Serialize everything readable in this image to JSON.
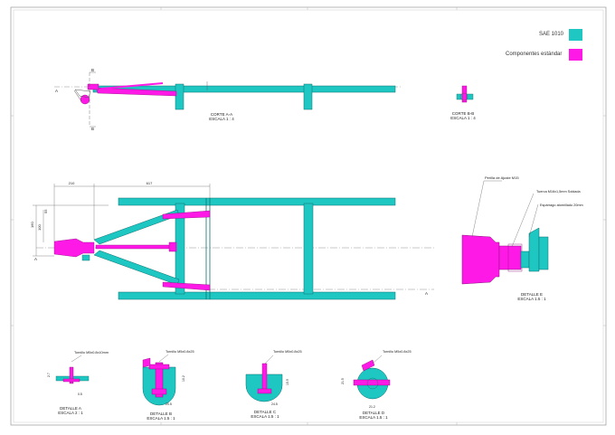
{
  "legend": {
    "items": [
      {
        "label": "SAE 1010",
        "color": "#1fc7c3"
      },
      {
        "label": "Componentes estándar",
        "color": "#ff19e6"
      }
    ]
  },
  "colors": {
    "frame": "#1fc7c3",
    "standard": "#ff19e6",
    "line": "#5a5a5a"
  },
  "views": {
    "corte_aa": {
      "title": "CORTE A-A",
      "scale": "ESCALA 1 : 4"
    },
    "corte_bb": {
      "title": "CORTE B-B",
      "scale": "ESCALA 1 : 4"
    },
    "detalle_e": {
      "title": "DETALLE E",
      "scale": "ESCALA 1.5 : 1"
    },
    "detalle_a": {
      "title": "DETALLE A",
      "scale": "ESCALA 2 : 1",
      "callout": "Tornillo M5x0.8x10mm"
    },
    "detalle_b": {
      "title": "DETALLE B",
      "scale": "ESCALA 1.5 : 1",
      "callout": "Tornillo M5x0.8x25"
    },
    "detalle_c": {
      "title": "DETALLE C",
      "scale": "ESCALA 1.5 : 1",
      "callout": "Tornillo M5x0.8x25"
    },
    "detalle_d": {
      "title": "DETALLE D",
      "scale": "ESCALA 1.5 : 1",
      "callout": "Tornillo M5x0.8x25"
    }
  },
  "callouts": {
    "perilla": "Perilla de Ajuste M15",
    "tuerca": "Tuerca M16x1,5mm Soldada",
    "esparrago": "Espárrago atornillado 20mm"
  },
  "dimensions": {
    "d1": "210",
    "d2": "617",
    "d3": "160",
    "d4": "100",
    "d5": "55",
    "a_h": "2.7",
    "a_w": "0.5",
    "b_v": "10.2",
    "b_h": "20.5",
    "c_v": "15.9",
    "c_h": "24.5",
    "d_v": "21.5",
    "d_h": "21.2"
  },
  "section_marks": {
    "a": "A",
    "b": "B"
  }
}
